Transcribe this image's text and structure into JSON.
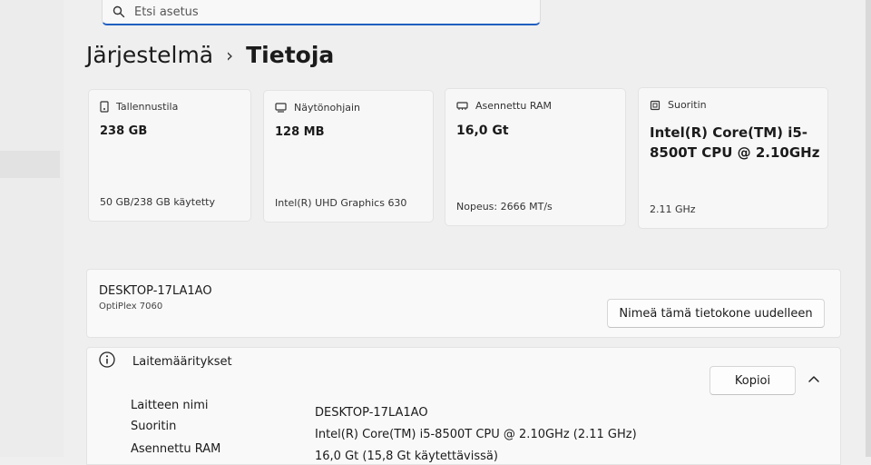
{
  "search": {
    "placeholder": "Etsi asetus"
  },
  "header": {
    "parent": "Järjestelmä",
    "separator": "›",
    "current": "Tietoja"
  },
  "cards": [
    {
      "label": "Tallennustila",
      "value": "238 GB",
      "sub": "50 GB/238 GB käytetty",
      "icon": "storage-icon"
    },
    {
      "label": "Näytönohjain",
      "value": "128 MB",
      "sub": "Intel(R) UHD Graphics 630",
      "icon": "display-adapter-icon"
    },
    {
      "label": "Asennettu RAM",
      "value": "16,0 Gt",
      "sub": "Nopeus: 2666 MT/s",
      "icon": "ram-icon"
    },
    {
      "label": "Suoritin",
      "value": "Intel(R) Core(TM) i5-8500T CPU @ 2.10GHz",
      "sub": "2.11 GHz",
      "icon": "processor-icon"
    }
  ],
  "device": {
    "name": "DESKTOP-17LA1AO",
    "model": "OptiPlex 7060",
    "rename_label": "Nimeä tämä tietokone uudelleen"
  },
  "specs": {
    "title": "Laitemääritykset",
    "copy_label": "Kopioi",
    "rows": [
      {
        "label": "Laitteen nimi",
        "value": "DESKTOP-17LA1AO"
      },
      {
        "label": "Suoritin",
        "value": "Intel(R) Core(TM) i5-8500T CPU @ 2.10GHz (2.11 GHz)"
      },
      {
        "label": "Asennettu RAM",
        "value": "16,0 Gt (15,8 Gt käytettävissä)"
      }
    ]
  },
  "colors": {
    "accent": "#1f5fbf",
    "background": "#efefef",
    "card": "#f7f7f7"
  }
}
